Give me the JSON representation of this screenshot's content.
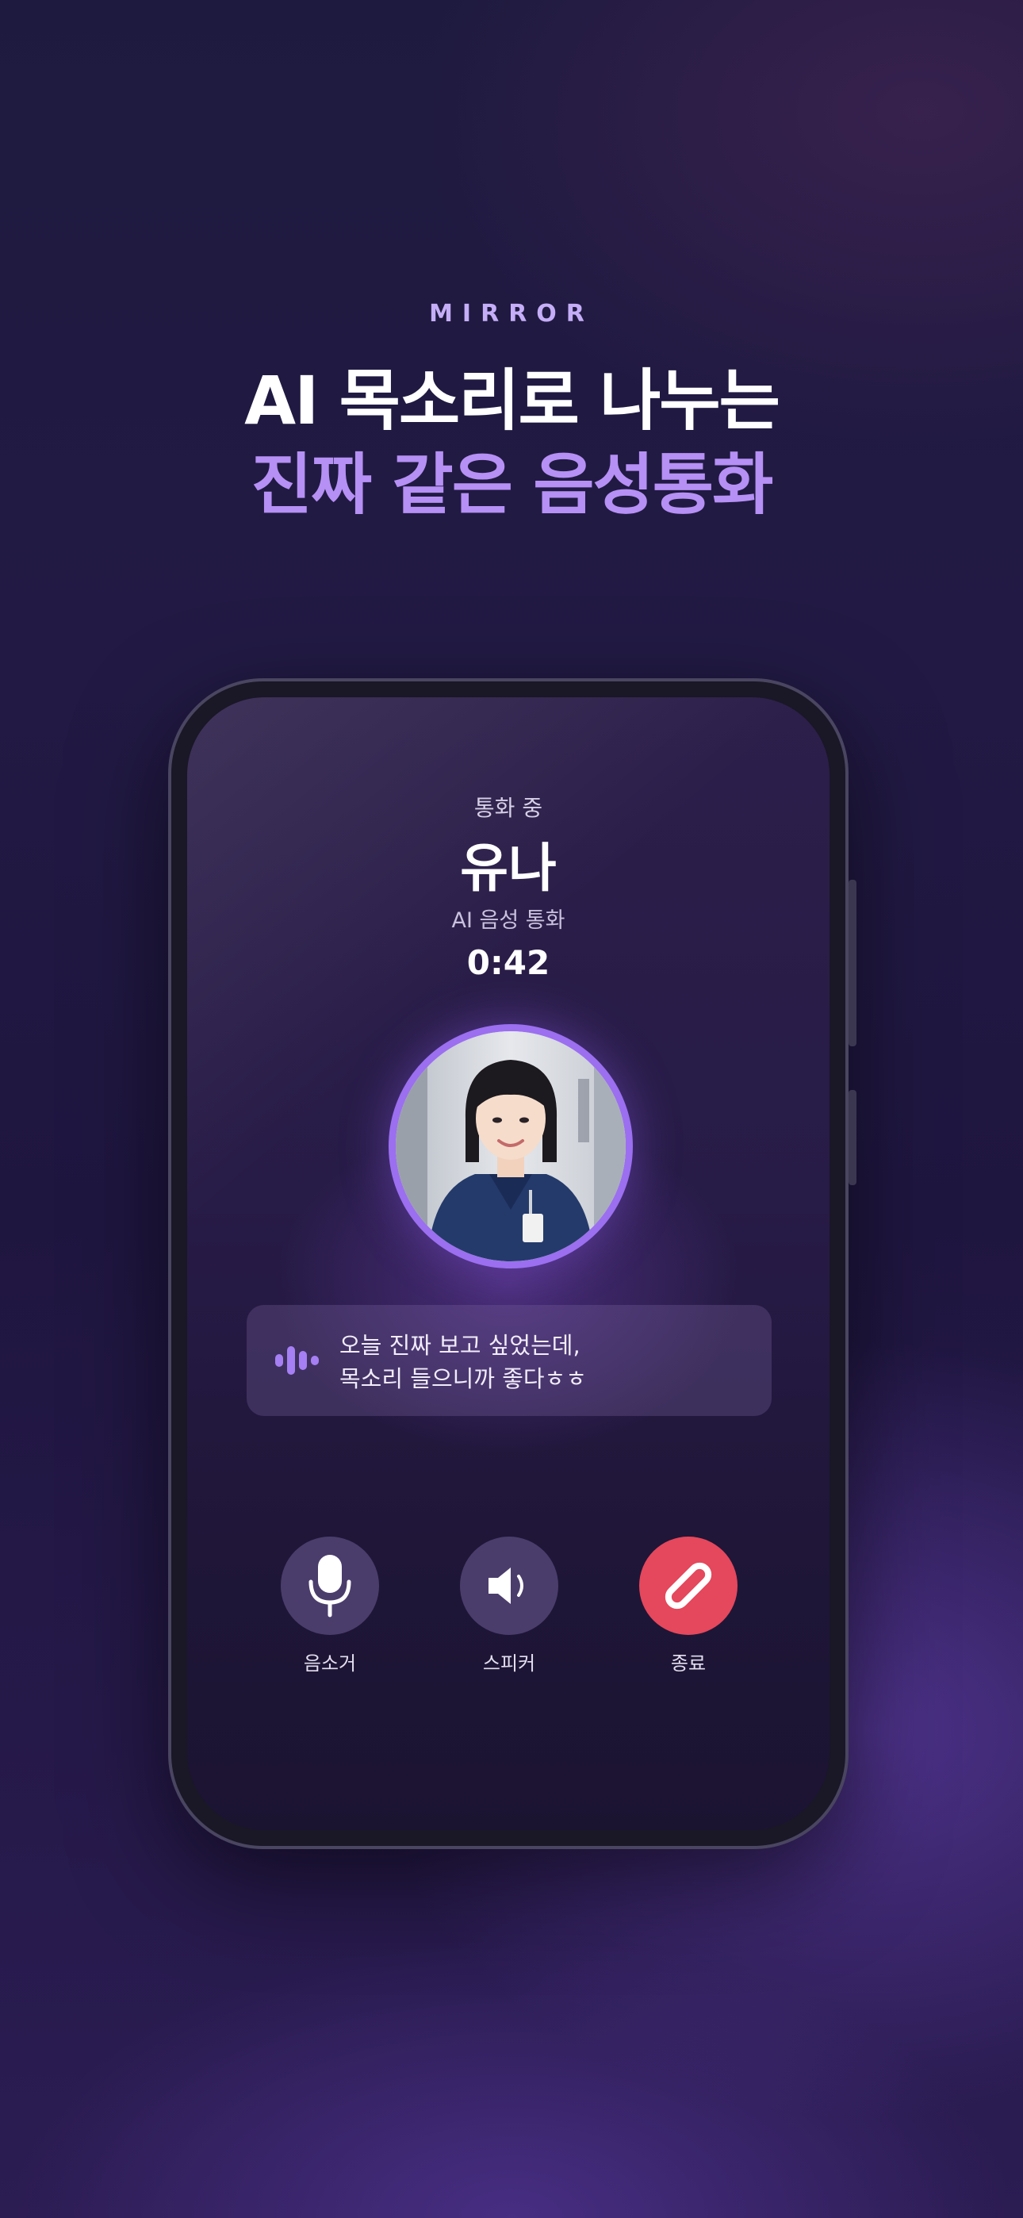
{
  "brand": "MIRROR",
  "headline": {
    "line1": "AI 목소리로 나누는",
    "line2": "진짜 같은 음성통화"
  },
  "call": {
    "status": "통화 중",
    "caller_name": "유나",
    "call_type": "AI 음성 통화",
    "duration": "0:42"
  },
  "message": {
    "line1": "오늘 진짜 보고 싶었는데,",
    "line2": "목소리 들으니까 좋다ㅎㅎ"
  },
  "controls": [
    {
      "label": "음소거",
      "icon": "microphone-icon"
    },
    {
      "label": "스피커",
      "icon": "speaker-icon"
    },
    {
      "label": "종료",
      "icon": "end-call-icon"
    }
  ],
  "colors": {
    "accent": "#9b6ff0",
    "headline_accent": "#b690f5",
    "end_call": "#e5475c",
    "control_bg": "#4a3d6c"
  }
}
